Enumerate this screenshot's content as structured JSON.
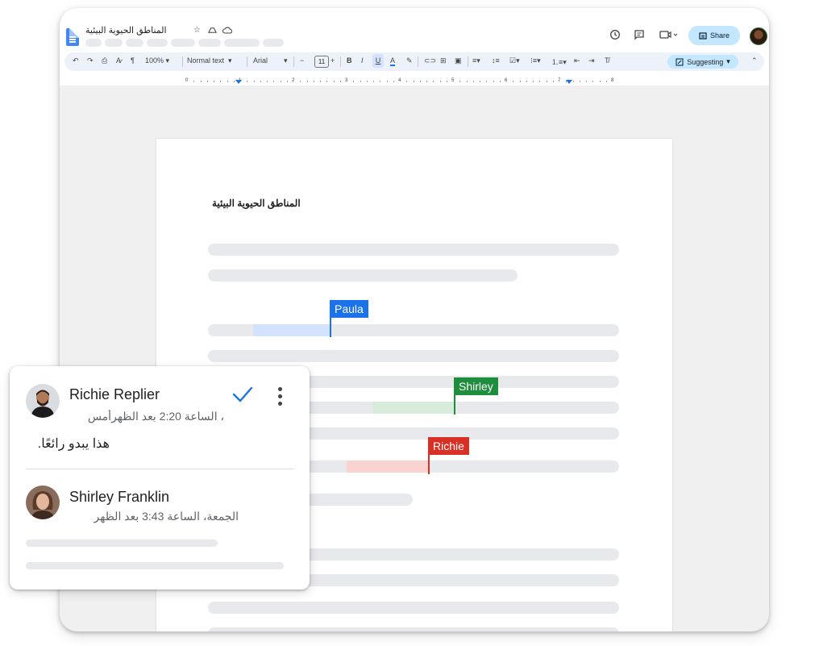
{
  "doc": {
    "title": "المناطق الحيوية البيئية",
    "heading": "المناطق الحيوية البيئية"
  },
  "header": {
    "share_label": "Share",
    "icons": [
      "star-icon",
      "drive-move-icon",
      "cloud-saved-icon",
      "history-icon",
      "comments-icon",
      "video-call-icon"
    ]
  },
  "toolbar": {
    "zoom": "100%",
    "style": "Normal text",
    "font": "Arial",
    "font_size": "11",
    "mode": "Suggesting"
  },
  "ruler": {
    "numbers": [
      "0",
      "1",
      "2",
      "3",
      "4",
      "5",
      "6",
      "7",
      "8"
    ]
  },
  "collaborators": [
    {
      "name": "Paula",
      "color": "#1a73e8"
    },
    {
      "name": "Shirley",
      "color": "#1e8e3e"
    },
    {
      "name": "Richie",
      "color": "#d93025"
    }
  ],
  "comments": [
    {
      "author": "Richie Replier",
      "time": "، الساعة 2:20 بعد الظهرأمس",
      "text": "هذا يبدو رائعًا."
    },
    {
      "author": "Shirley Franklin",
      "time": "الجمعة، الساعة 3:43 بعد الظهر"
    }
  ],
  "colors": {
    "accent": "#1a73e8",
    "share_bg": "#c2e7ff",
    "toolbar_bg": "#edf2fa"
  }
}
